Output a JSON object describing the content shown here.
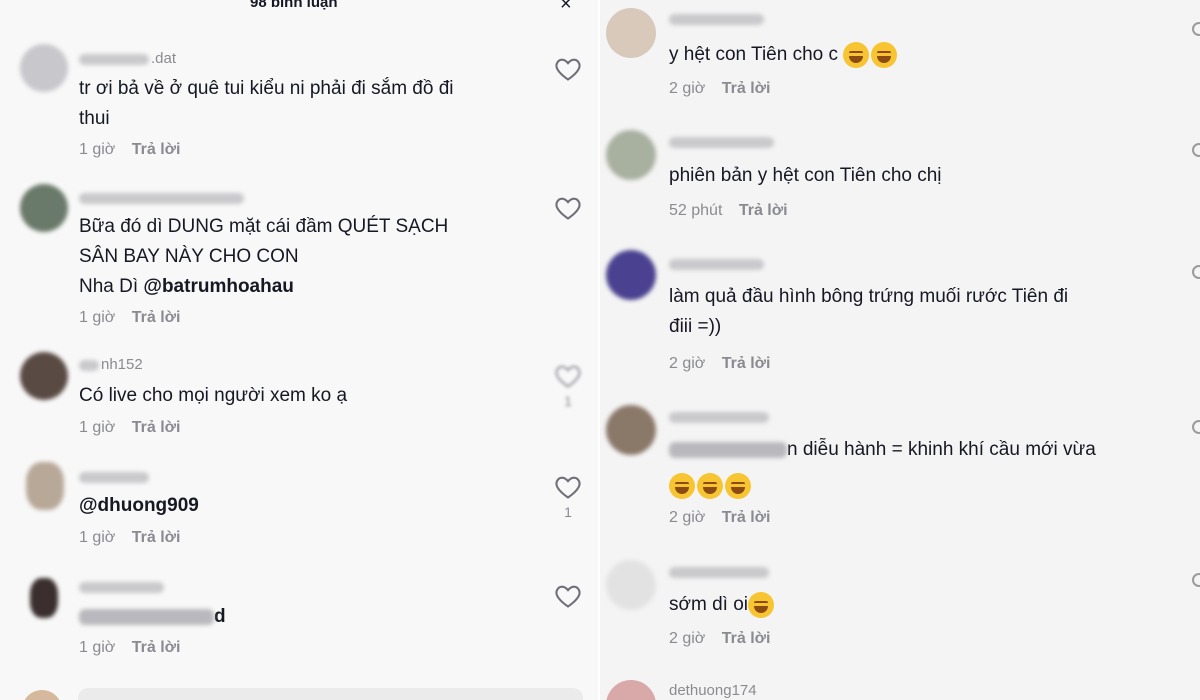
{
  "left_panel": {
    "header": {
      "title": "98 bình luận",
      "close_icon": "×"
    },
    "comments": [
      {
        "username": ".dat",
        "username_masked": true,
        "text_lines": [
          "tr ơi bả về ở quê tui kiểu ni phải đi sắm đồ đi",
          "thui"
        ],
        "time": "1 giờ",
        "reply": "Trả lời",
        "likes": ""
      },
      {
        "username": "",
        "username_masked": true,
        "text_lines": [
          "Bữa đó dì DUNG mặt cái đầm QUÉT SẠCH",
          "SÂN BAY NÀY CHO CON"
        ],
        "text_prefix": "Nha Dì ",
        "mention": "@batrumhoahau",
        "time": "1 giờ",
        "reply": "Trả lời",
        "likes": ""
      },
      {
        "username": "nh152",
        "username_masked": true,
        "text_lines": [
          "Có live cho mọi người xem ko ạ"
        ],
        "time": "1 giờ",
        "reply": "Trả lời",
        "likes": "1"
      },
      {
        "username": "",
        "username_masked": true,
        "mention": "@dhuong909",
        "time": "1 giờ",
        "reply": "Trả lời",
        "likes": "1"
      },
      {
        "username": "",
        "username_masked": true,
        "mention_suffix": "d",
        "time": "1 giờ",
        "reply": "Trả lời",
        "likes": ""
      }
    ]
  },
  "right_panel": {
    "comments": [
      {
        "username": "",
        "username_masked": true,
        "text": "y hệt con Tiên cho c",
        "emoji_count": 2,
        "time": "2 giờ",
        "reply": "Trả lời"
      },
      {
        "username": "",
        "username_masked": true,
        "text": "phiên bản y hệt con Tiên cho chị",
        "time": "52 phút",
        "reply": "Trả lời"
      },
      {
        "username": "",
        "username_masked": true,
        "text_lines": [
          "làm quả đầu hình bông trứng muối rước Tiên đi",
          "điii =))"
        ],
        "time": "2 giờ",
        "reply": "Trả lời"
      },
      {
        "username": "",
        "username_masked": true,
        "text": "n diễu hành = khinh khí cầu mới vừa",
        "emoji_count": 3,
        "time": "2 giờ",
        "reply": "Trả lời"
      },
      {
        "username": "",
        "username_masked": true,
        "text": "sớm dì oi",
        "emoji_count": 1,
        "time": "2 giờ",
        "reply": "Trả lời"
      },
      {
        "username": "dethuong174",
        "username_masked": false
      }
    ]
  },
  "icons": {
    "like": "heart-outline-icon",
    "close": "close-icon"
  }
}
